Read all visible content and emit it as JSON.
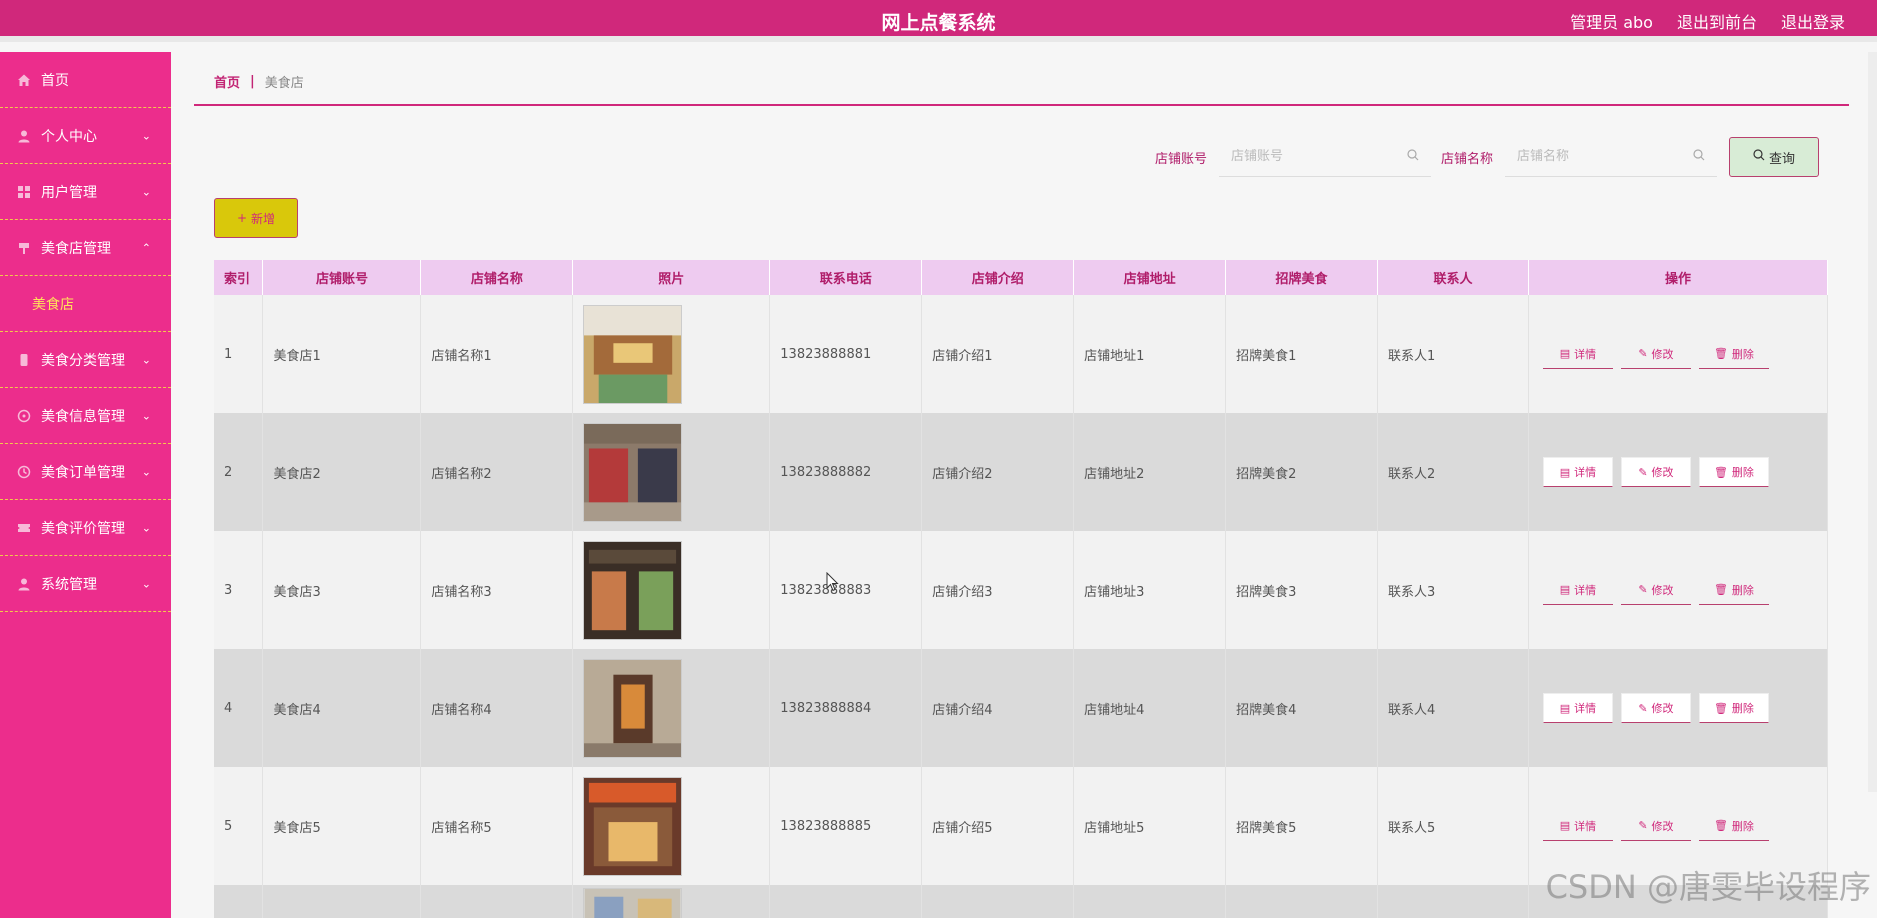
{
  "header": {
    "title": "网上点餐系统",
    "admin": "管理员 abo",
    "back_front": "退出到前台",
    "logout": "退出登录"
  },
  "sidebar": {
    "items": [
      {
        "label": "首页",
        "icon": "home-icon"
      },
      {
        "label": "个人中心",
        "icon": "user-icon"
      },
      {
        "label": "用户管理",
        "icon": "grid-icon"
      },
      {
        "label": "美食店管理",
        "icon": "pin-icon"
      },
      {
        "label": "美食分类管理",
        "icon": "phone-icon"
      },
      {
        "label": "美食信息管理",
        "icon": "clock-face-icon"
      },
      {
        "label": "美食订单管理",
        "icon": "clock-icon"
      },
      {
        "label": "美食评价管理",
        "icon": "ticket-icon"
      },
      {
        "label": "系统管理",
        "icon": "user-icon"
      }
    ],
    "submenu_label": "美食店"
  },
  "breadcrumb": {
    "home": "首页",
    "separator": "|",
    "current": "美食店"
  },
  "search": {
    "account_label": "店铺账号",
    "account_placeholder": "店铺账号",
    "name_label": "店铺名称",
    "name_placeholder": "店铺名称",
    "query_button": "查询"
  },
  "add_button": "新增",
  "table": {
    "headers": [
      "索引",
      "店铺账号",
      "店铺名称",
      "照片",
      "联系电话",
      "店铺介绍",
      "店铺地址",
      "招牌美食",
      "联系人",
      "操作"
    ],
    "rows": [
      {
        "index": "1",
        "account": "美食店1",
        "name": "店铺名称1",
        "phone": "13823888881",
        "intro": "店铺介绍1",
        "address": "店铺地址1",
        "food": "招牌美食1",
        "contact": "联系人1"
      },
      {
        "index": "2",
        "account": "美食店2",
        "name": "店铺名称2",
        "phone": "13823888882",
        "intro": "店铺介绍2",
        "address": "店铺地址2",
        "food": "招牌美食2",
        "contact": "联系人2"
      },
      {
        "index": "3",
        "account": "美食店3",
        "name": "店铺名称3",
        "phone": "13823888883",
        "intro": "店铺介绍3",
        "address": "店铺地址3",
        "food": "招牌美食3",
        "contact": "联系人3"
      },
      {
        "index": "4",
        "account": "美食店4",
        "name": "店铺名称4",
        "phone": "13823888884",
        "intro": "店铺介绍4",
        "address": "店铺地址4",
        "food": "招牌美食4",
        "contact": "联系人4"
      },
      {
        "index": "5",
        "account": "美食店5",
        "name": "店铺名称5",
        "phone": "13823888885",
        "intro": "店铺介绍5",
        "address": "店铺地址5",
        "food": "招牌美食5",
        "contact": "联系人5"
      }
    ],
    "ops": {
      "detail": "详情",
      "edit": "修改",
      "delete": "删除"
    }
  },
  "watermark": "CSDN @唐雯毕设程序",
  "colors": {
    "topbar": "#d0287b",
    "sidebar": "#ec2d8c",
    "accent": "#b01d6a",
    "submenu_text": "#ffe25a",
    "header_row": "#eecbf0"
  }
}
